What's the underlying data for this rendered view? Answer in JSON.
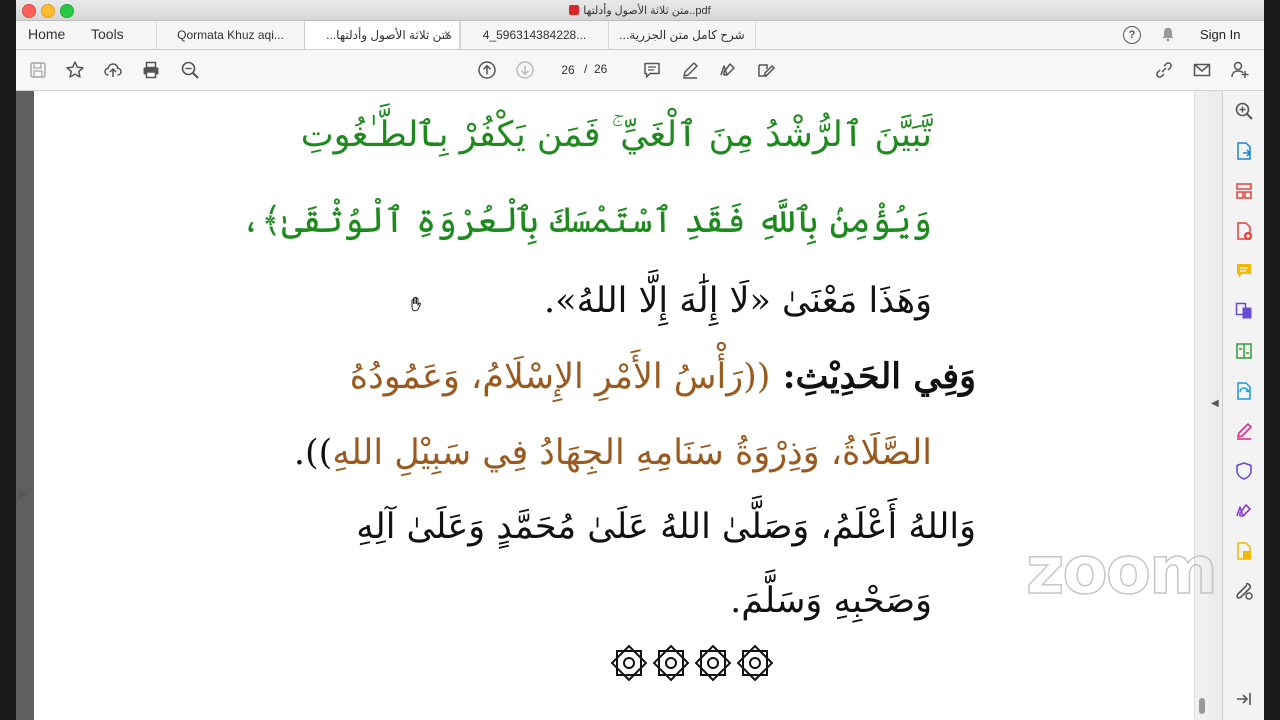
{
  "window": {
    "title": "متن ثلاثة الأصول وأدلتها..pdf"
  },
  "nav": {
    "home_label": "Home",
    "tools_label": "Tools",
    "sign_in_label": "Sign In"
  },
  "tabs": [
    {
      "label": "Qormata Khuz aqi...",
      "active": false
    },
    {
      "label": "متن ثلاثة الأصول وأدلتها...",
      "active": true
    },
    {
      "label": "4_596314384228...",
      "active": false
    },
    {
      "label": "شرح كامل متن الجزرية...",
      "active": false
    }
  ],
  "toolbar": {
    "current_page": "26",
    "page_separator": "/",
    "total_pages": "26"
  },
  "document": {
    "lines": [
      {
        "text": "تَّبَيَّنَ ٱلرُّشْدُ مِنَ ٱلْغَيِّ ۚ فَمَن يَكْفُرْ بِٱلطَّـٰغُوتِ",
        "color": "#1e8a1e"
      },
      {
        "text": "وَيُؤْمِنۢ بِٱللَّهِ فَقَدِ ٱسْتَمْسَكَ بِٱلْعُرْوَةِ ٱلْوُثْقَىٰ﴾،",
        "color": "#1e8a1e"
      },
      {
        "text": "وَهَذَا مَعْنَىٰ «لَا إِلَٰهَ إِلَّا اللهُ».",
        "color": "#111111"
      },
      {
        "text_label": "وَفِي الحَدِيْثِ: ",
        "text_quote": "((رَأْسُ الأَمْرِ الإِسْلَامُ، وَعَمُودُهُ",
        "color_label": "#111111",
        "color_quote": "#9a5a1f"
      },
      {
        "text": "الصَّلَاةُ، وَذِرْوَةُ سَنَامِهِ الجِهَادُ فِي سَبِيْلِ اللهِ",
        "tail": ")).",
        "color": "#9a5a1f"
      },
      {
        "text": "وَاللهُ أَعْلَمُ، وَصَلَّىٰ اللهُ عَلَىٰ مُحَمَّدٍ وَعَلَىٰ آلِهِ",
        "color": "#111111"
      },
      {
        "text": "وَصَحْبِهِ وَسَلَّمَ.",
        "color": "#111111"
      }
    ]
  },
  "watermark": {
    "text": "zoom"
  },
  "icons": {
    "toolbar_left": [
      "save-icon",
      "star-icon",
      "upload-icon",
      "print-icon",
      "search-zoom-icon"
    ],
    "toolbar_nav": [
      "page-up-icon",
      "page-down-icon"
    ],
    "toolbar_tools": [
      "comment-icon",
      "highlight-pen-icon",
      "sign-icon",
      "fill-sign-icon"
    ],
    "toolbar_right": [
      "link-icon",
      "mail-icon",
      "add-user-icon"
    ],
    "right_panel": [
      "zoom-panel-icon",
      "export-pdf-icon",
      "organize-pages-icon",
      "create-pdf-icon",
      "comment-panel-icon",
      "combine-files-icon",
      "compress-icon",
      "convert-icon",
      "fill-sign-panel-icon",
      "protect-icon",
      "sign-panel-icon",
      "send-review-icon",
      "more-tools-icon"
    ]
  },
  "colors": {
    "green_quran": "#1e8a1e",
    "brown_hadith": "#9a5a1f",
    "body_text": "#111111"
  }
}
